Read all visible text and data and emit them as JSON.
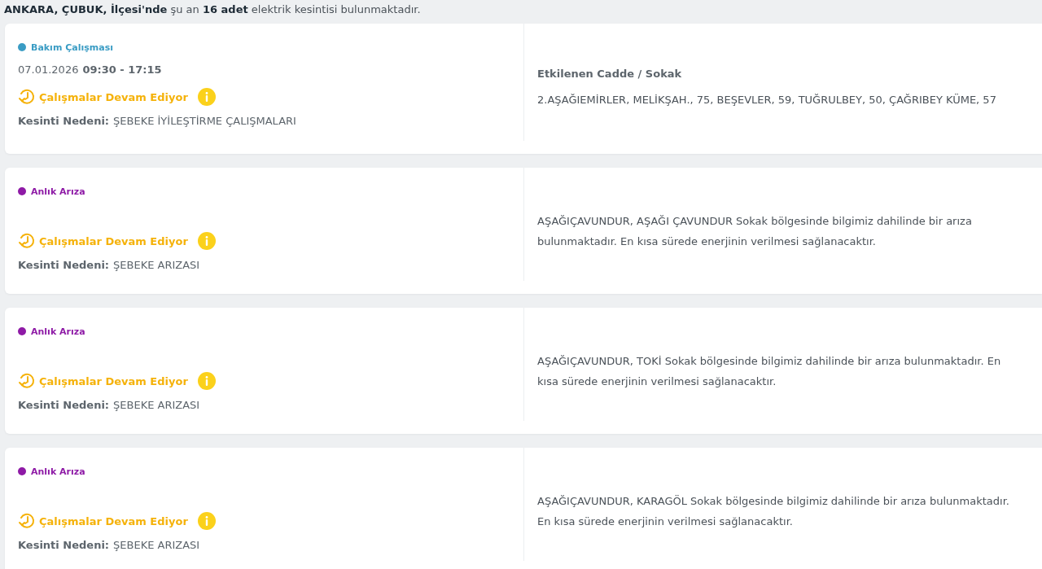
{
  "summary": "**ANKARA, ÇUBUK, İlçesi'nde** şu an **16 adet** elektrik kesintisi bulunmaktadır.",
  "outages": [
    {
      "type": "Bakım Çalışması",
      "color": "#3a9cc4",
      "date": "07.01.2026",
      "time": "09:30 - 17:15",
      "status": "Çalışmalar Devam Ediyor",
      "reason_label": "Kesinti Nedeni:",
      "reason": "ŞEBEKE İYİLEŞTİRME ÇALIŞMALARI",
      "streets_title": "Etkilenen Cadde / Sokak",
      "streets": "2.AŞAĞIEMİRLER, MELİKŞAH., 75, BEŞEVLER, 59, TUĞRULBEY, 50, ÇAĞRIBEY KÜME, 57"
    },
    {
      "type": "Anlık Arıza",
      "color": "#8e1aa6",
      "status": "Çalışmalar Devam Ediyor",
      "reason_label": "Kesinti Nedeni:",
      "reason": "ŞEBEKE ARIZASI",
      "streets": "AŞAĞIÇAVUNDUR, AŞAĞI ÇAVUNDUR Sokak bölgesinde bilgimiz dahilinde bir arıza bulunmaktadır. En kısa sürede enerjinin verilmesi sağlanacaktır."
    },
    {
      "type": "Anlık Arıza",
      "color": "#8e1aa6",
      "status": "Çalışmalar Devam Ediyor",
      "reason_label": "Kesinti Nedeni:",
      "reason": "ŞEBEKE ARIZASI",
      "streets": "AŞAĞIÇAVUNDUR, TOKİ Sokak bölgesinde bilgimiz dahilinde bir arıza bulunmaktadır. En kısa sürede enerjinin verilmesi sağlanacaktır."
    },
    {
      "type": "Anlık Arıza",
      "color": "#8e1aa6",
      "status": "Çalışmalar Devam Ediyor",
      "reason_label": "Kesinti Nedeni:",
      "reason": "ŞEBEKE ARIZASI",
      "streets": "AŞAĞIÇAVUNDUR, KARAGÖL Sokak bölgesinde bilgimiz dahilinde bir arıza bulunmaktadır. En kısa sürede enerjinin verilmesi sağlanacaktır."
    }
  ]
}
